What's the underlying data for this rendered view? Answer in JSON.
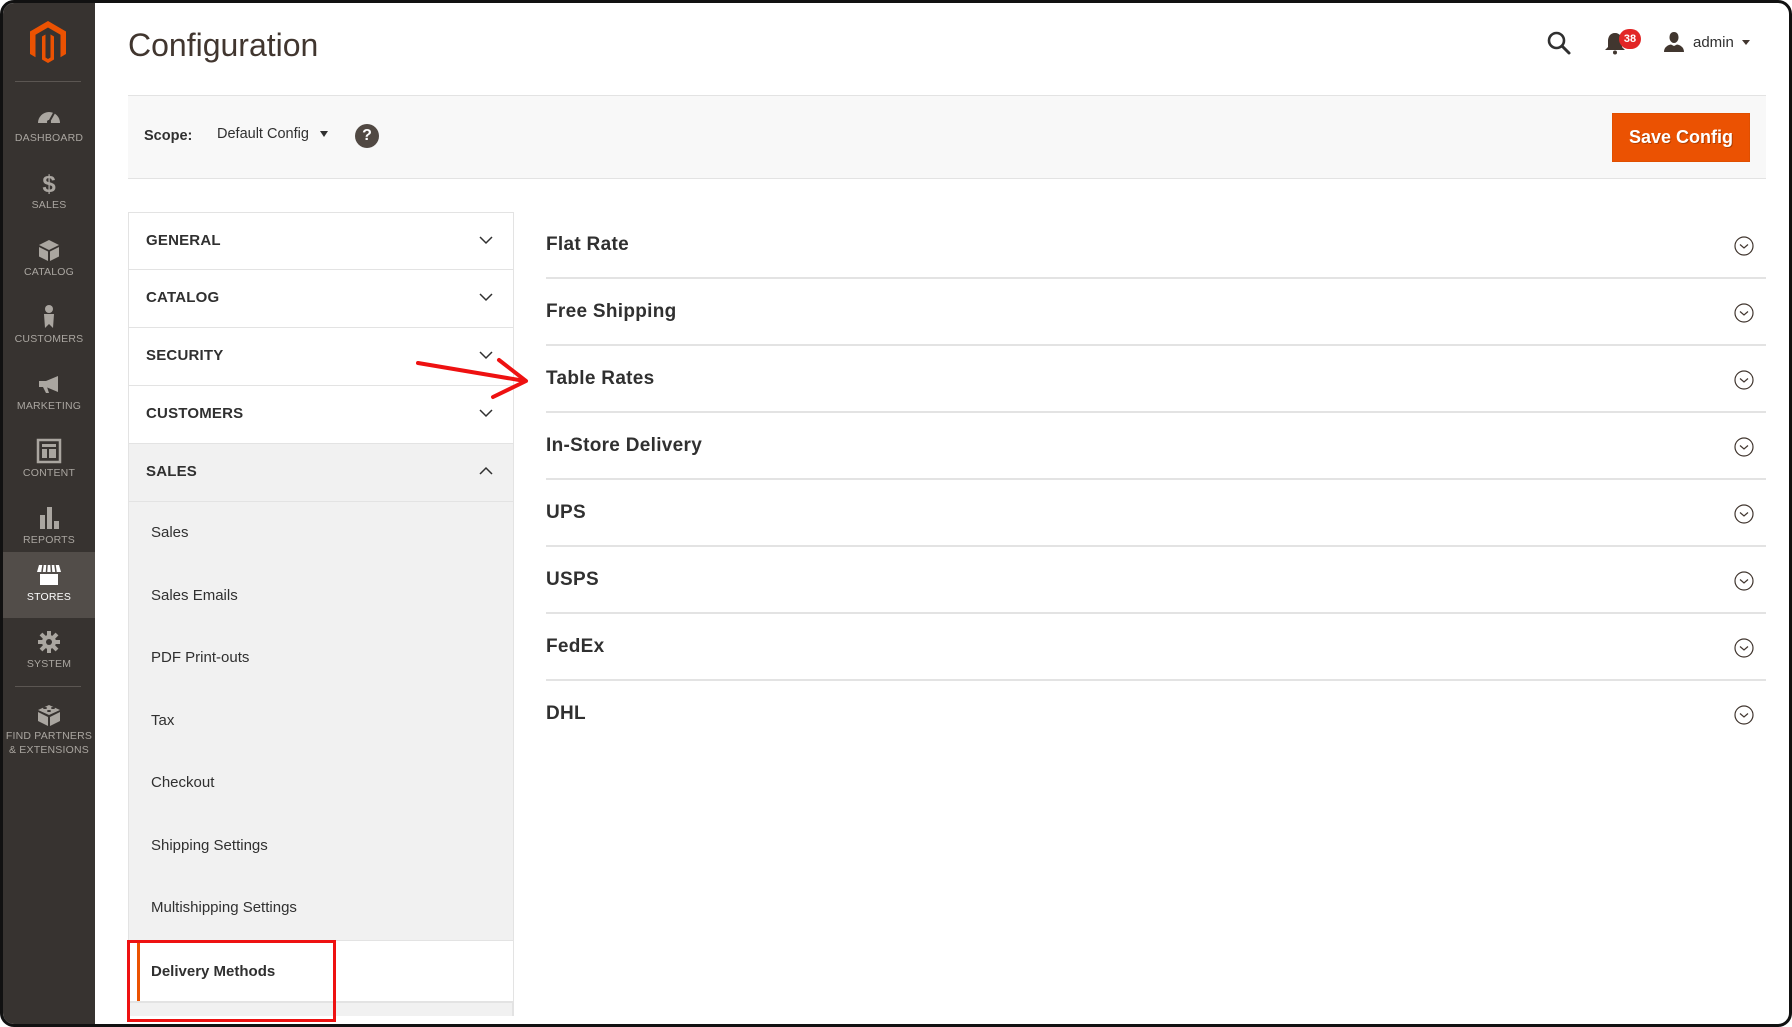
{
  "sidebar": {
    "brand_color": "#eb5202",
    "items": [
      {
        "label": "DASHBOARD",
        "icon": "dashboard-icon"
      },
      {
        "label": "SALES",
        "icon": "dollar-icon"
      },
      {
        "label": "CATALOG",
        "icon": "box-icon"
      },
      {
        "label": "CUSTOMERS",
        "icon": "person-icon"
      },
      {
        "label": "MARKETING",
        "icon": "megaphone-icon"
      },
      {
        "label": "CONTENT",
        "icon": "layout-icon"
      },
      {
        "label": "REPORTS",
        "icon": "bar-chart-icon"
      },
      {
        "label": "STORES",
        "icon": "storefront-icon",
        "active": true
      },
      {
        "label": "SYSTEM",
        "icon": "gear-icon"
      },
      {
        "label": "FIND PARTNERS",
        "label2": "& EXTENSIONS",
        "icon": "lego-brick-icon"
      }
    ]
  },
  "header": {
    "title": "Configuration",
    "notifications_count": "38",
    "user_name": "admin"
  },
  "scope": {
    "label": "Scope:",
    "value": "Default Config",
    "help": "?",
    "save_label": "Save Config"
  },
  "config_nav": {
    "tabs": [
      {
        "label": "GENERAL",
        "expanded": false
      },
      {
        "label": "CATALOG",
        "expanded": false
      },
      {
        "label": "SECURITY",
        "expanded": false
      },
      {
        "label": "CUSTOMERS",
        "expanded": false
      },
      {
        "label": "SALES",
        "expanded": true
      }
    ],
    "sales_items": [
      {
        "label": "Sales"
      },
      {
        "label": "Sales Emails"
      },
      {
        "label": "PDF Print-outs"
      },
      {
        "label": "Tax"
      },
      {
        "label": "Checkout"
      },
      {
        "label": "Shipping Settings"
      },
      {
        "label": "Multishipping Settings"
      },
      {
        "label": "Delivery Methods",
        "active": true
      }
    ]
  },
  "sections": [
    {
      "label": "Flat Rate"
    },
    {
      "label": "Free Shipping"
    },
    {
      "label": "Table Rates"
    },
    {
      "label": "In-Store Delivery"
    },
    {
      "label": "UPS"
    },
    {
      "label": "USPS"
    },
    {
      "label": "FedEx"
    },
    {
      "label": "DHL"
    }
  ],
  "annotations": {
    "arrow_target": "Table Rates",
    "highlight_target": "Delivery Methods",
    "color": "#ee1111"
  }
}
